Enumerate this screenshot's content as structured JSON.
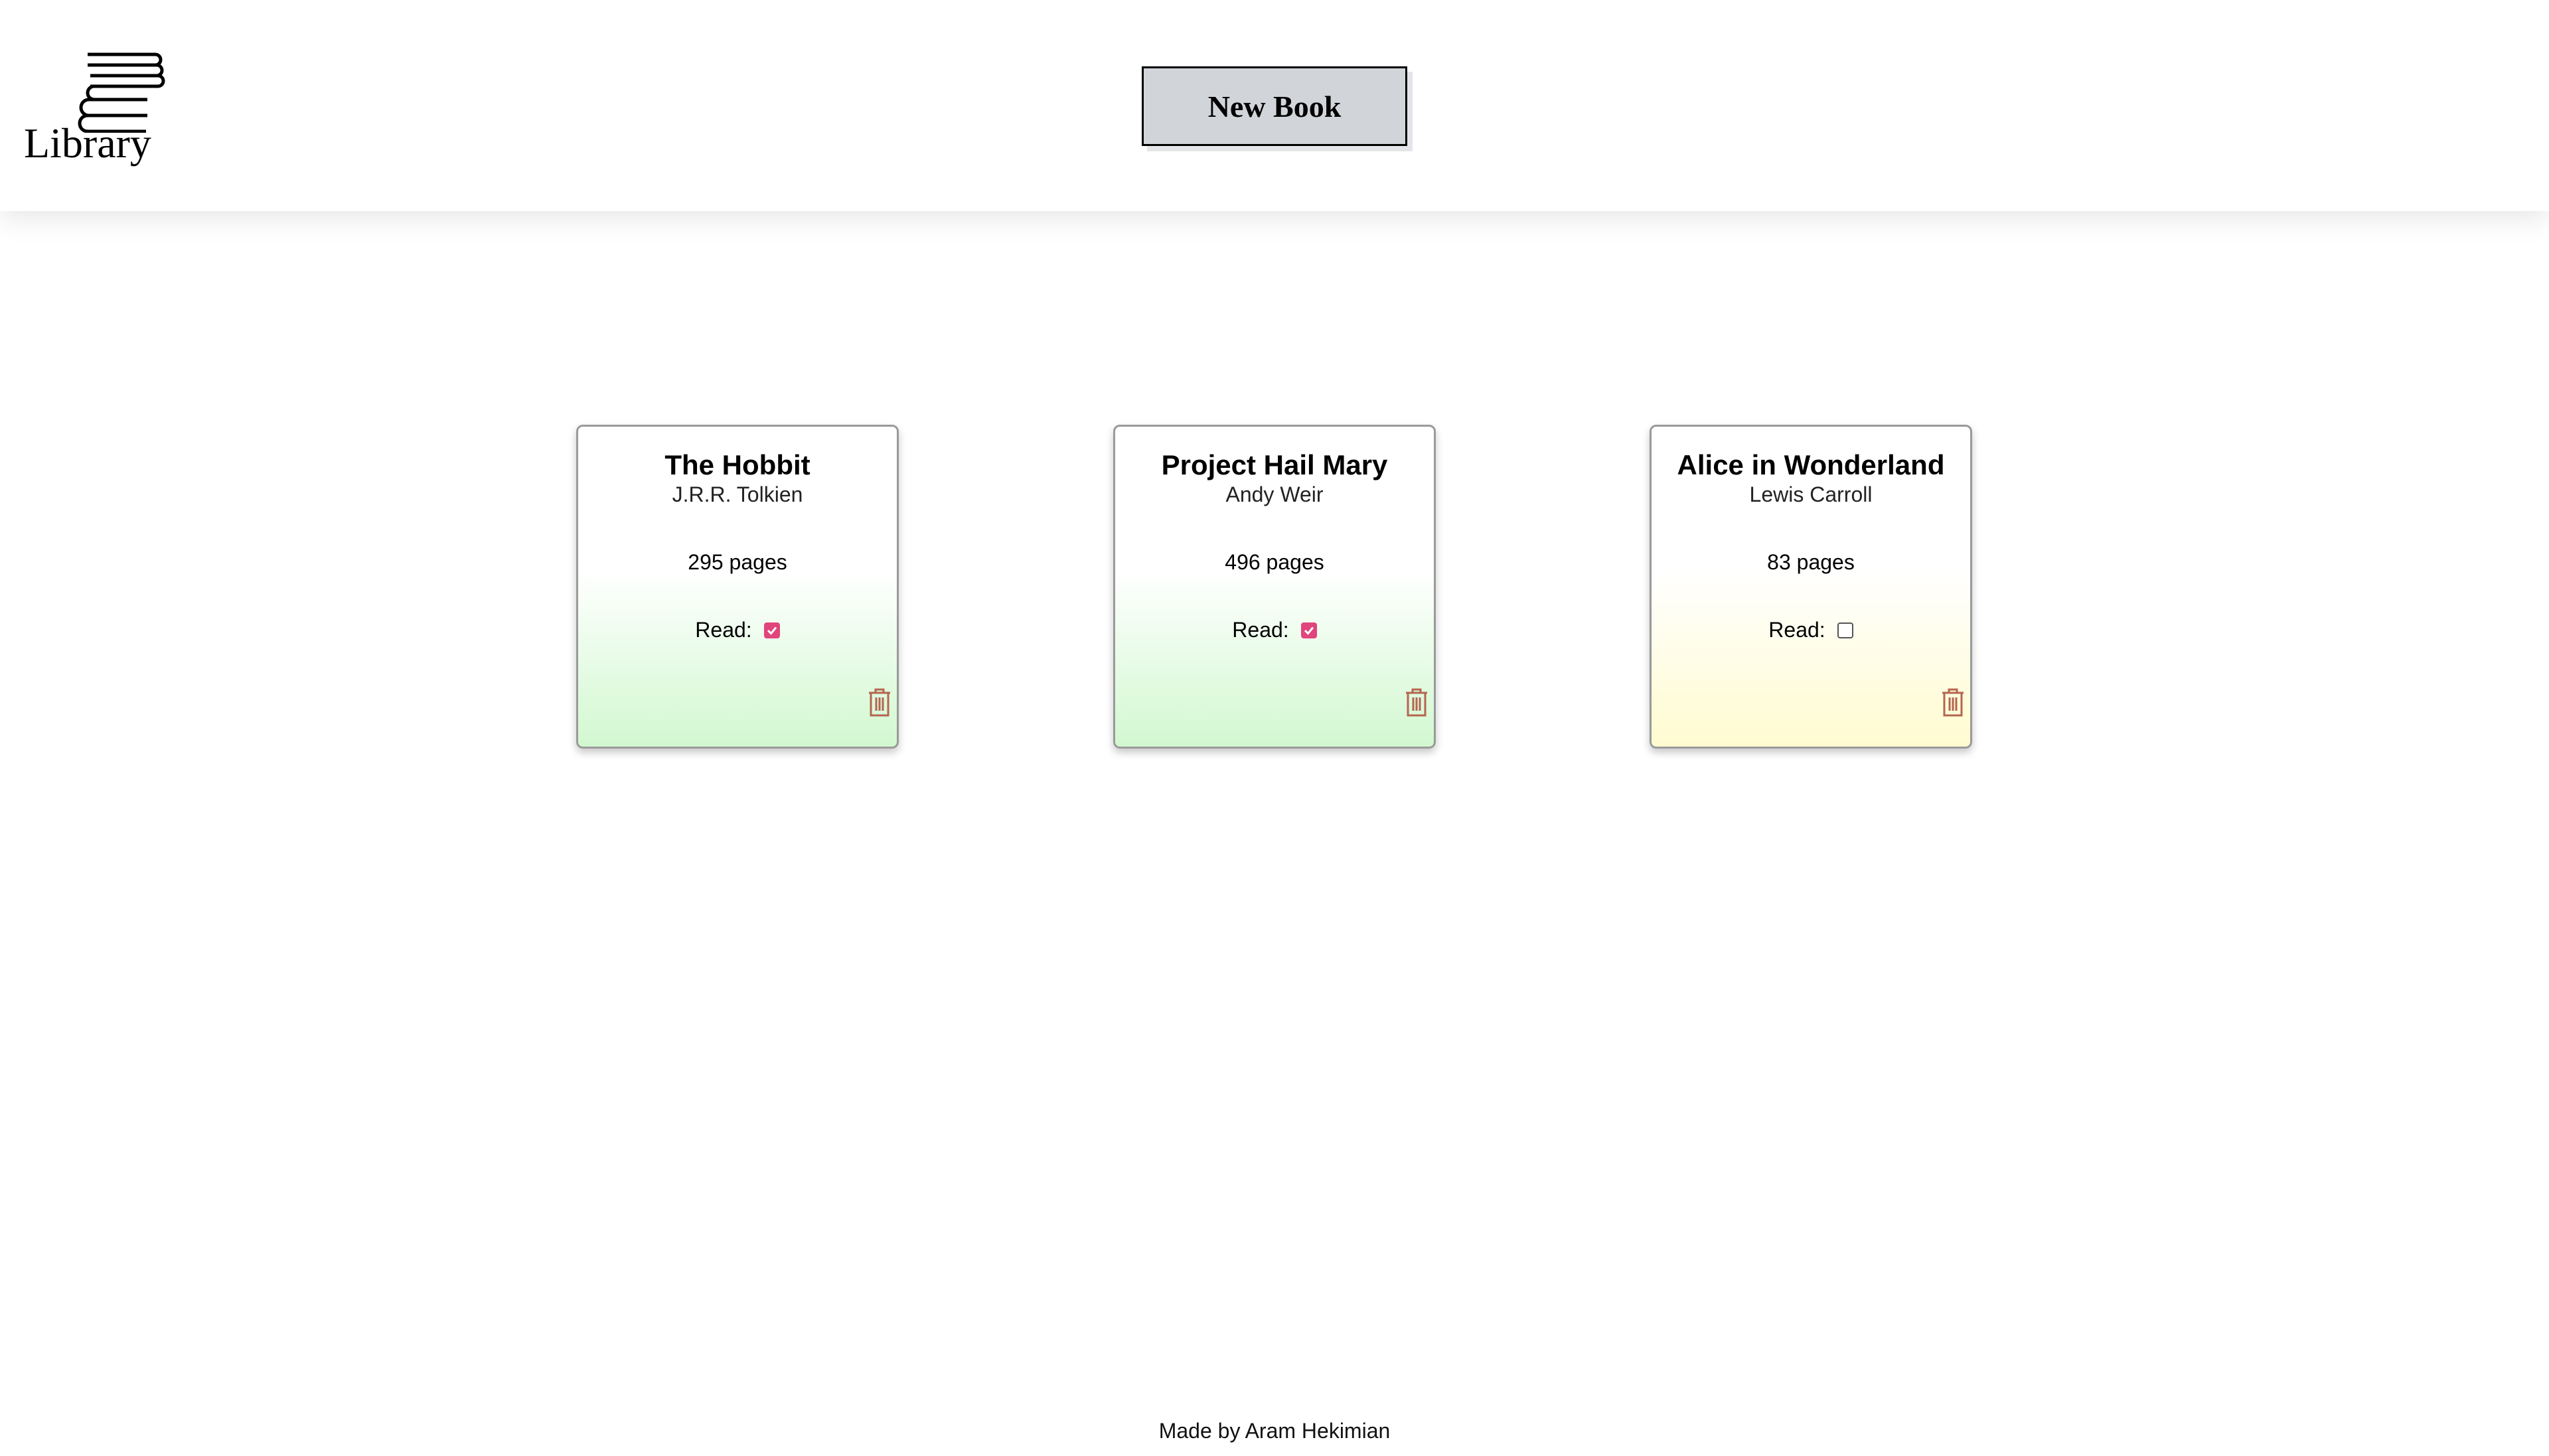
{
  "header": {
    "logo_text": "Library",
    "logo_icon": "stacked-books-icon",
    "new_book_label": "New Book"
  },
  "books": [
    {
      "title": "The Hobbit",
      "author": "J.R.R. Tolkien",
      "pages": "295 pages",
      "read_label": "Read:",
      "read": true
    },
    {
      "title": "Project Hail Mary",
      "author": "Andy Weir",
      "pages": "496 pages",
      "read_label": "Read:",
      "read": true
    },
    {
      "title": "Alice in Wonderland",
      "author": "Lewis Carroll",
      "pages": "83 pages",
      "read_label": "Read:",
      "read": false
    }
  ],
  "colors": {
    "read_card_bottom": "#d2f8d0",
    "unread_card_bottom": "#fffbd0",
    "checkbox_accent": "#e0457b",
    "delete_icon": "#b5654f",
    "button_bg": "#d1d4d9"
  },
  "footer": {
    "credit": "Made by Aram Hekimian"
  }
}
